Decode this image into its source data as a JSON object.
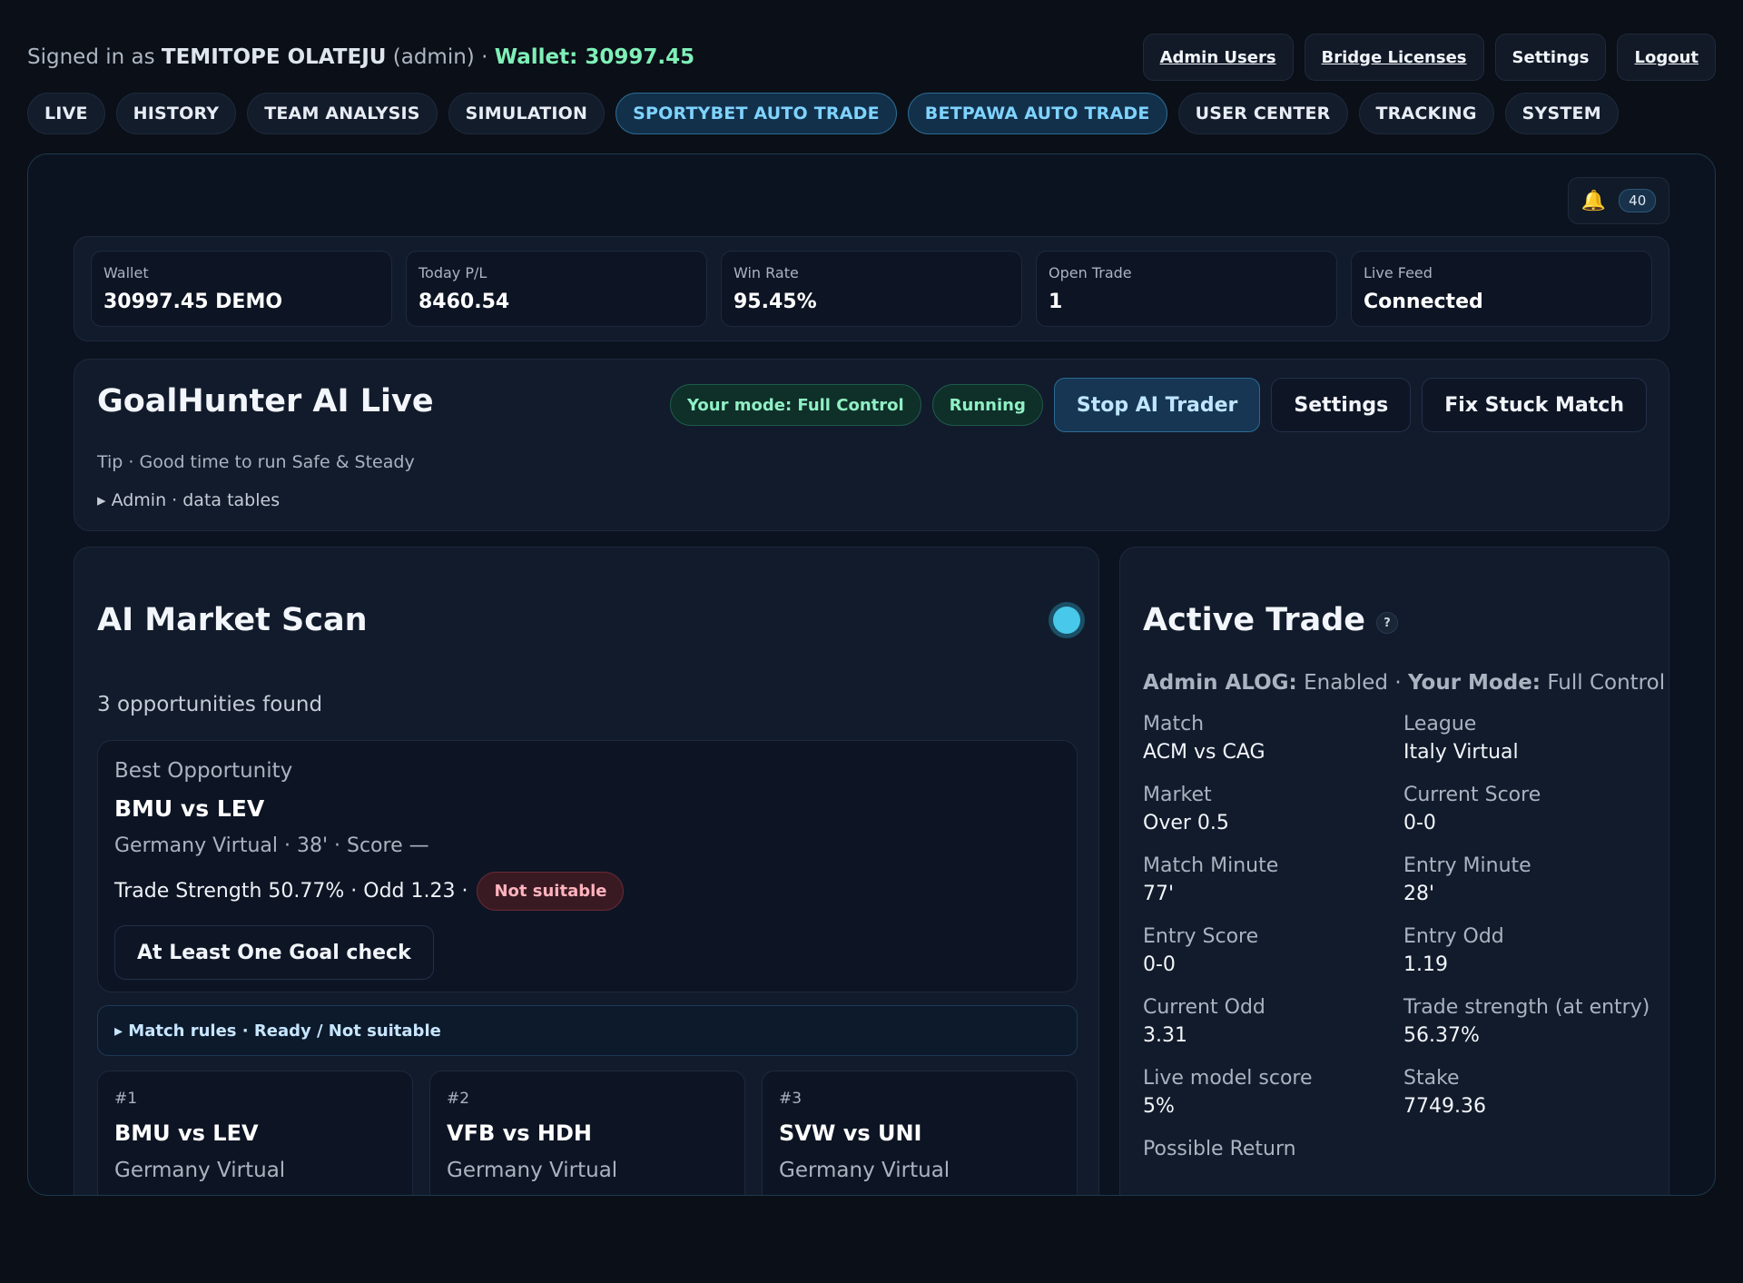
{
  "header": {
    "signed_prefix": "Signed in as",
    "user_name": "TEMITOPE OLATEJU",
    "role": "(admin) ·",
    "wallet_label": "Wallet: 30997.45",
    "actions": [
      "Admin Users",
      "Bridge Licenses",
      "Settings",
      "Logout"
    ]
  },
  "nav": {
    "tabs": [
      "LIVE",
      "HISTORY",
      "TEAM ANALYSIS",
      "SIMULATION",
      "SPORTYBET AUTO TRADE",
      "BETPAWA AUTO TRADE",
      "USER CENTER",
      "TRACKING",
      "SYSTEM"
    ]
  },
  "notifications": {
    "icon": "bell-icon",
    "count": "40"
  },
  "stats": [
    {
      "label": "Wallet",
      "value": "30997.45 DEMO"
    },
    {
      "label": "Today P/L",
      "value": "8460.54"
    },
    {
      "label": "Win Rate",
      "value": "95.45%"
    },
    {
      "label": "Open Trade",
      "value": "1"
    },
    {
      "label": "Live Feed",
      "value": "Connected"
    }
  ],
  "hero": {
    "title": "GoalHunter AI Live",
    "tip": "Tip · Good time to run Safe & Steady",
    "admin_toggle": "▸ Admin · data tables",
    "mode_pill": "Your mode: Full Control",
    "status_pill": "Running",
    "stop_button": "Stop AI Trader",
    "settings_button": "Settings",
    "fix_button": "Fix Stuck Match"
  },
  "scan": {
    "title": "AI Market Scan",
    "found": "3 opportunities found",
    "best": {
      "label": "Best Opportunity",
      "match": "BMU vs LEV",
      "details": "Germany Virtual · 38' · Score —",
      "strength": "Trade Strength 50.77% · Odd 1.23 ·",
      "badge": "Not suitable",
      "check_button": "At Least One Goal check"
    },
    "rules": "▸ Match rules · Ready / Not suitable",
    "opportunities": [
      {
        "rank": "#1",
        "match": "BMU vs LEV",
        "league": "Germany Virtual"
      },
      {
        "rank": "#2",
        "match": "VFB vs HDH",
        "league": "Germany Virtual"
      },
      {
        "rank": "#3",
        "match": "SVW vs UNI",
        "league": "Germany Virtual"
      }
    ]
  },
  "trade": {
    "title": "Active Trade",
    "help": "?",
    "alog_label": "Admin ALOG:",
    "alog_value": "Enabled ·",
    "mode_label": "Your Mode:",
    "mode_value": "Full Control",
    "fields": [
      {
        "k": "Match",
        "v": "ACM vs CAG"
      },
      {
        "k": "League",
        "v": "Italy Virtual"
      },
      {
        "k": "Market",
        "v": "Over 0.5"
      },
      {
        "k": "Current Score",
        "v": "0-0"
      },
      {
        "k": "Match Minute",
        "v": "77'"
      },
      {
        "k": "Entry Minute",
        "v": "28'"
      },
      {
        "k": "Entry Score",
        "v": "0-0"
      },
      {
        "k": "Entry Odd",
        "v": "1.19"
      },
      {
        "k": "Current Odd",
        "v": "3.31"
      },
      {
        "k": "Trade strength (at entry)",
        "v": "56.37%"
      },
      {
        "k": "Live model score",
        "v": "5%"
      },
      {
        "k": "Stake",
        "v": "7749.36"
      },
      {
        "k": "Possible Return",
        "v": ""
      }
    ]
  },
  "colors": {
    "accent": "#7fd3ff",
    "success": "#8ff0c4",
    "danger": "#ffb3bd",
    "wallet": "#7ff0b8"
  }
}
